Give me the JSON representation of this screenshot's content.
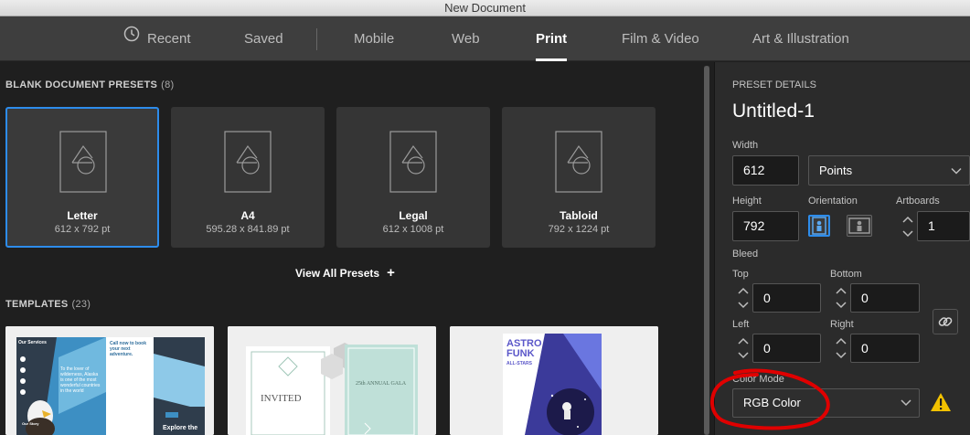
{
  "window": {
    "title": "New Document"
  },
  "tabs": [
    {
      "label": "Recent",
      "icon": "clock-icon"
    },
    {
      "label": "Saved"
    },
    {
      "label": "Mobile"
    },
    {
      "label": "Web"
    },
    {
      "label": "Print",
      "active": true
    },
    {
      "label": "Film & Video"
    },
    {
      "label": "Art & Illustration"
    }
  ],
  "presets": {
    "title": "BLANK DOCUMENT PRESETS",
    "count": "(8)",
    "items": [
      {
        "name": "Letter",
        "size": "612 x 792 pt",
        "selected": true
      },
      {
        "name": "A4",
        "size": "595.28 x 841.89 pt"
      },
      {
        "name": "Legal",
        "size": "612 x 1008 pt"
      },
      {
        "name": "Tabloid",
        "size": "792 x 1224 pt"
      }
    ],
    "view_all": "View All Presets"
  },
  "templates": {
    "title": "TEMPLATES",
    "count": "(23)",
    "items": [
      {
        "texts": [
          "Our Services",
          "Call now to book your next adventure.",
          "To the lover of wilderness, Alaska is one of the most wonderful countries in the world",
          "Our Story",
          "Explore the"
        ]
      },
      {
        "texts": [
          "INVITED",
          "25th ANNUAL GALA"
        ]
      },
      {
        "texts": [
          "ASTRO",
          "FUNK",
          "ALL-STARS"
        ]
      }
    ]
  },
  "details": {
    "title": "PRESET DETAILS",
    "doc_name": "Untitled-1",
    "width_label": "Width",
    "width": "612",
    "units": "Points",
    "height_label": "Height",
    "height": "792",
    "orientation_label": "Orientation",
    "artboards_label": "Artboards",
    "artboards": "1",
    "bleed_label": "Bleed",
    "top_label": "Top",
    "top": "0",
    "bottom_label": "Bottom",
    "bottom": "0",
    "left_label": "Left",
    "left": "0",
    "right_label": "Right",
    "right": "0",
    "color_mode_label": "Color Mode",
    "color_mode": "RGB Color"
  },
  "colors": {
    "accent": "#2d8ceb",
    "annotation": "#e00000",
    "warning": "#f2c200"
  }
}
